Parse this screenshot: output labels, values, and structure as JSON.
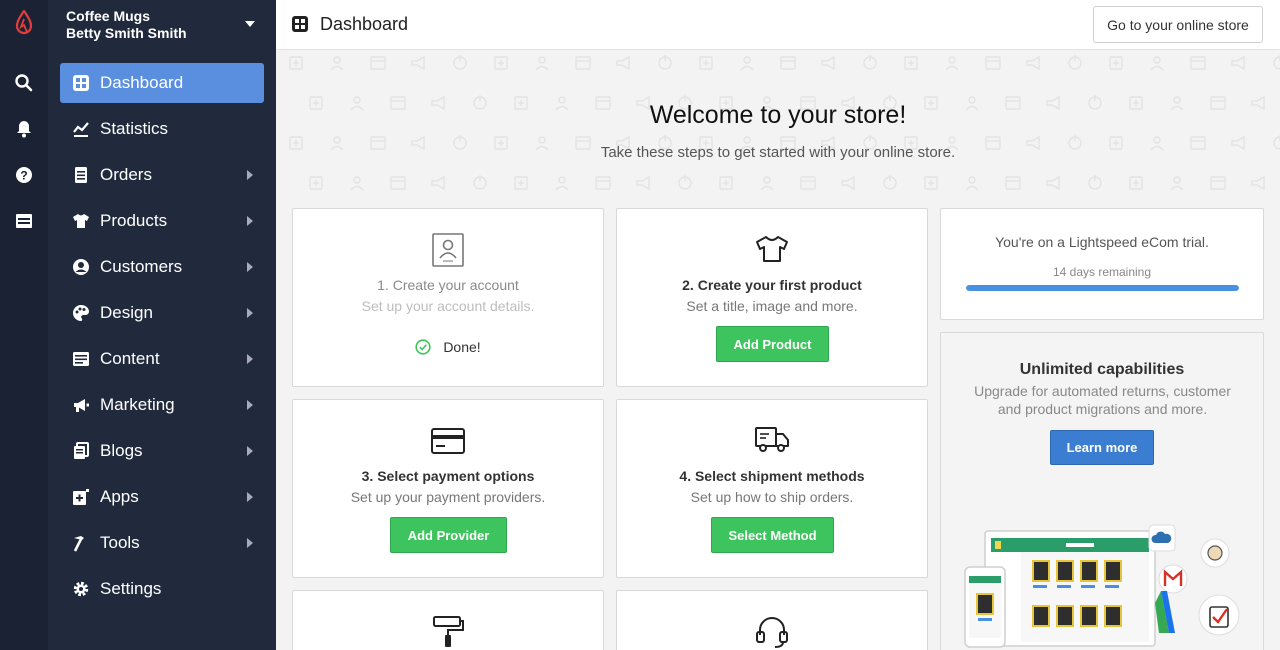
{
  "sidebar": {
    "store_name": "Coffee Mugs",
    "user_name": "Betty Smith Smith",
    "items": [
      {
        "label": "Dashboard",
        "icon": "dashboard-icon",
        "active": true,
        "has_arrow": false
      },
      {
        "label": "Statistics",
        "icon": "statistics-icon",
        "active": false,
        "has_arrow": false
      },
      {
        "label": "Orders",
        "icon": "orders-icon",
        "active": false,
        "has_arrow": true
      },
      {
        "label": "Products",
        "icon": "products-icon",
        "active": false,
        "has_arrow": true
      },
      {
        "label": "Customers",
        "icon": "customers-icon",
        "active": false,
        "has_arrow": true
      },
      {
        "label": "Design",
        "icon": "palette-icon",
        "active": false,
        "has_arrow": true
      },
      {
        "label": "Content",
        "icon": "content-icon",
        "active": false,
        "has_arrow": true
      },
      {
        "label": "Marketing",
        "icon": "megaphone-icon",
        "active": false,
        "has_arrow": true
      },
      {
        "label": "Blogs",
        "icon": "blogs-icon",
        "active": false,
        "has_arrow": true
      },
      {
        "label": "Apps",
        "icon": "apps-icon",
        "active": false,
        "has_arrow": true
      },
      {
        "label": "Tools",
        "icon": "tools-icon",
        "active": false,
        "has_arrow": true
      },
      {
        "label": "Settings",
        "icon": "gear-icon",
        "active": false,
        "has_arrow": false
      }
    ]
  },
  "rail": {
    "icons": [
      "lightspeed-logo-icon",
      "search-icon",
      "bell-icon",
      "help-icon",
      "storefront-icon"
    ]
  },
  "header": {
    "title": "Dashboard",
    "store_button": "Go to your online store"
  },
  "hero": {
    "title": "Welcome to your store!",
    "subtitle": "Take these steps to get started with your online store."
  },
  "steps": [
    {
      "title": "1. Create your account",
      "subtitle": "Set up your account details.",
      "status": "Done!",
      "icon": "account-icon"
    },
    {
      "title": "2. Create your first product",
      "subtitle": "Set a title, image and more.",
      "button": "Add Product",
      "icon": "tshirt-icon"
    },
    {
      "title": "3. Select payment options",
      "subtitle": "Set up your payment providers.",
      "button": "Add Provider",
      "icon": "credit-card-icon"
    },
    {
      "title": "4. Select shipment methods",
      "subtitle": "Set up how to ship orders.",
      "button": "Select Method",
      "icon": "truck-icon"
    }
  ],
  "trial": {
    "text": "You're on a Lightspeed eCom trial.",
    "days": "14 days remaining",
    "progress": 1.0
  },
  "upgrade": {
    "title": "Unlimited capabilities",
    "subtitle": "Upgrade for automated returns, customer and product migrations and more.",
    "button": "Learn more"
  },
  "colors": {
    "sidebar_bg": "#212a3d",
    "rail_bg": "#1b2233",
    "active_item": "#5a8fe0",
    "green_button": "#3ec45e",
    "blue_button": "#3b7dd0",
    "progress": "#4a90e2",
    "logo_red": "#e03e3e"
  }
}
